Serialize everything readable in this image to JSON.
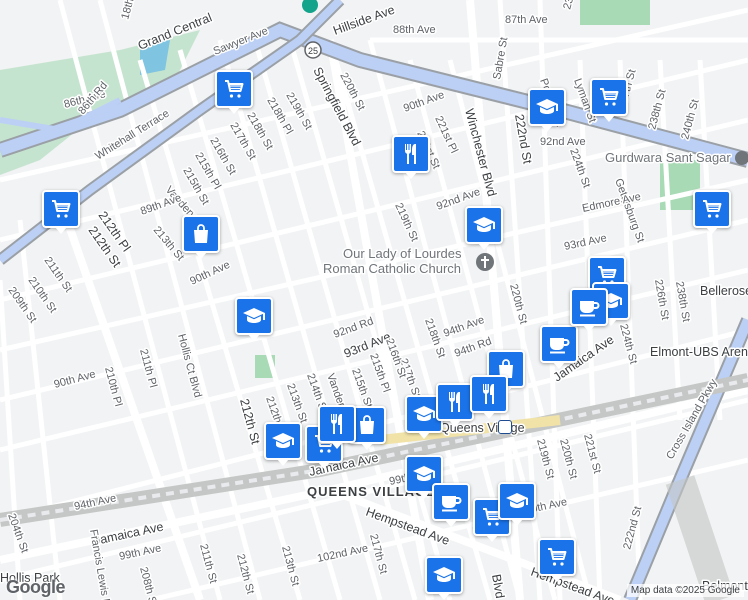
{
  "map": {
    "attribution": "Map data ©2025 Google",
    "logo": "Google",
    "colors": {
      "water_green": "#a8dab5",
      "highway": "#8ab4f8",
      "road": "#ffffff",
      "rail": "#bdc1c6",
      "pin": "#1a73e8"
    },
    "street_labels": [
      "18th St",
      "Grand Central",
      "Sawyer Ave",
      "Hillside Ave",
      "87th Ave",
      "88th Ave",
      "23rd St",
      "86th Ave",
      "86th Rd",
      "219th St",
      "218th Pl",
      "218th St",
      "217th St",
      "216th St",
      "215th Pl",
      "215th St",
      "Springfield Blvd",
      "220th St",
      "90th Ave",
      "221st Pl",
      "221st St",
      "Sabre St",
      "Winchester Blvd",
      "222nd St",
      "Pontiac St",
      "Lyman St",
      "237th St",
      "238th St",
      "240th St",
      "92nd Ave",
      "224th St",
      "Gurdwara Sant Sagar",
      "Gettysburg St",
      "Whitehall Terrace",
      "Vanderveer St",
      "89th Ave",
      "213th St",
      "212th Pl",
      "212th St",
      "211th St",
      "210th St",
      "209th St",
      "92nd Ave",
      "Edmore Ave",
      "219th St",
      "Our Lady of Lourdes",
      "Roman Catholic Church",
      "93rd Ave",
      "Bellerose Terrace",
      "90th Ave",
      "92nd Rd",
      "93rd Ave",
      "218th St",
      "94th Ave",
      "94th Rd",
      "220th St",
      "226th St",
      "238th St",
      "Hollis Ct Blvd",
      "211th Pl",
      "210th Pl",
      "90th Ave",
      "217th St",
      "216th St",
      "215th Pl",
      "215th St",
      "214th St",
      "Vanderveer St",
      "213th St",
      "212th Pl",
      "212th St",
      "Jamaica Ave",
      "224th St",
      "Elmont-UBS Arena",
      "Queens Village",
      "Cross Island Pkwy",
      "Jamaica Ave",
      "QUEENS VILLAGE",
      "219th St",
      "220th St",
      "221st St",
      "99th Ave",
      "100th Ave",
      "94th Ave",
      "Jamaica Ave",
      "Hempstead Ave",
      "204th St",
      "Francis Lewis Blvd",
      "99th Ave",
      "208th St",
      "211th St",
      "212th St",
      "213th St",
      "102nd Ave",
      "217th St",
      "Hempstead Ave",
      "222nd St",
      "Belmont",
      "Hollis Park",
      "Blvd"
    ],
    "markers": [
      {
        "id": "cart-1",
        "icon": "shopping-cart-icon",
        "label": "grocery"
      },
      {
        "id": "cart-2",
        "icon": "shopping-cart-icon",
        "label": "grocery"
      },
      {
        "id": "cart-3",
        "icon": "shopping-cart-icon",
        "label": "grocery"
      },
      {
        "id": "cart-4",
        "icon": "shopping-cart-icon",
        "label": "grocery"
      },
      {
        "id": "cart-5",
        "icon": "shopping-cart-icon",
        "label": "grocery"
      },
      {
        "id": "cart-6",
        "icon": "shopping-cart-icon",
        "label": "grocery"
      },
      {
        "id": "cart-7",
        "icon": "shopping-cart-icon",
        "label": "grocery"
      },
      {
        "id": "cart-8",
        "icon": "shopping-cart-icon",
        "label": "grocery"
      },
      {
        "id": "bag-1",
        "icon": "shopping-bag-icon",
        "label": "store"
      },
      {
        "id": "bag-2",
        "icon": "shopping-bag-icon",
        "label": "store"
      },
      {
        "id": "bag-3",
        "icon": "shopping-bag-icon",
        "label": "store"
      },
      {
        "id": "school-1",
        "icon": "graduation-cap-icon",
        "label": "school"
      },
      {
        "id": "school-2",
        "icon": "graduation-cap-icon",
        "label": "school"
      },
      {
        "id": "school-3",
        "icon": "graduation-cap-icon",
        "label": "school"
      },
      {
        "id": "school-4",
        "icon": "graduation-cap-icon",
        "label": "school"
      },
      {
        "id": "school-5",
        "icon": "graduation-cap-icon",
        "label": "school"
      },
      {
        "id": "school-6",
        "icon": "graduation-cap-icon",
        "label": "school"
      },
      {
        "id": "school-7",
        "icon": "graduation-cap-icon",
        "label": "school"
      },
      {
        "id": "school-8",
        "icon": "graduation-cap-icon",
        "label": "school"
      },
      {
        "id": "school-9",
        "icon": "graduation-cap-icon",
        "label": "school"
      },
      {
        "id": "food-1",
        "icon": "fork-knife-icon",
        "label": "restaurant"
      },
      {
        "id": "food-2",
        "icon": "fork-knife-icon",
        "label": "restaurant"
      },
      {
        "id": "food-3",
        "icon": "fork-knife-icon",
        "label": "restaurant"
      },
      {
        "id": "food-4",
        "icon": "fork-knife-icon",
        "label": "restaurant"
      },
      {
        "id": "cafe-1",
        "icon": "coffee-cup-icon",
        "label": "cafe"
      },
      {
        "id": "cafe-2",
        "icon": "coffee-cup-icon",
        "label": "cafe"
      },
      {
        "id": "cafe-3",
        "icon": "coffee-cup-icon",
        "label": "cafe"
      }
    ]
  }
}
